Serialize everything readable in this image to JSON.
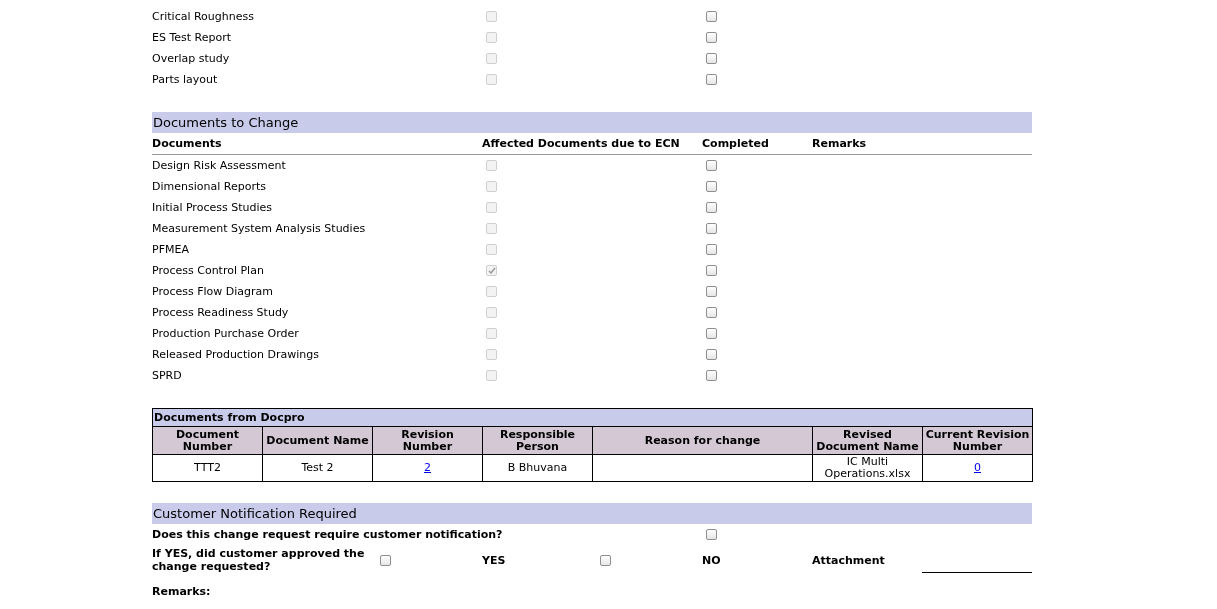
{
  "top_documents": [
    {
      "name": "Critical Roughness",
      "affected": {
        "checked": false,
        "disabled": true
      },
      "completed": {
        "checked": false,
        "disabled": false
      }
    },
    {
      "name": "ES Test Report",
      "affected": {
        "checked": false,
        "disabled": true
      },
      "completed": {
        "checked": false,
        "disabled": false
      }
    },
    {
      "name": "Overlap study",
      "affected": {
        "checked": false,
        "disabled": true
      },
      "completed": {
        "checked": false,
        "disabled": false
      }
    },
    {
      "name": "Parts layout",
      "affected": {
        "checked": false,
        "disabled": true
      },
      "completed": {
        "checked": false,
        "disabled": false
      }
    }
  ],
  "documents_to_change": {
    "title": "Documents to Change",
    "columns": [
      "Documents",
      "Affected Documents due to ECN",
      "Completed",
      "Remarks"
    ],
    "rows": [
      {
        "name": "Design Risk Assessment",
        "affected": {
          "checked": false,
          "disabled": true
        },
        "completed": {
          "checked": false,
          "disabled": false
        }
      },
      {
        "name": "Dimensional Reports",
        "affected": {
          "checked": false,
          "disabled": true
        },
        "completed": {
          "checked": false,
          "disabled": false
        }
      },
      {
        "name": "Initial Process Studies",
        "affected": {
          "checked": false,
          "disabled": true
        },
        "completed": {
          "checked": false,
          "disabled": false
        }
      },
      {
        "name": "Measurement System Analysis Studies",
        "affected": {
          "checked": false,
          "disabled": true
        },
        "completed": {
          "checked": false,
          "disabled": false
        }
      },
      {
        "name": "PFMEA",
        "affected": {
          "checked": false,
          "disabled": true
        },
        "completed": {
          "checked": false,
          "disabled": false
        }
      },
      {
        "name": "Process Control Plan",
        "affected": {
          "checked": true,
          "disabled": true
        },
        "completed": {
          "checked": false,
          "disabled": false
        }
      },
      {
        "name": "Process Flow Diagram",
        "affected": {
          "checked": false,
          "disabled": true
        },
        "completed": {
          "checked": false,
          "disabled": false
        }
      },
      {
        "name": "Process Readiness Study",
        "affected": {
          "checked": false,
          "disabled": true
        },
        "completed": {
          "checked": false,
          "disabled": false
        }
      },
      {
        "name": "Production Purchase Order",
        "affected": {
          "checked": false,
          "disabled": true
        },
        "completed": {
          "checked": false,
          "disabled": false
        }
      },
      {
        "name": "Released Production Drawings",
        "affected": {
          "checked": false,
          "disabled": true
        },
        "completed": {
          "checked": false,
          "disabled": false
        }
      },
      {
        "name": "SPRD",
        "affected": {
          "checked": false,
          "disabled": true
        },
        "completed": {
          "checked": false,
          "disabled": false
        }
      }
    ]
  },
  "docpro": {
    "title": "Documents from Docpro",
    "columns": [
      "Document Number",
      "Document Name",
      "Revision Number",
      "Responsible Person",
      "Reason for change",
      "Revised Document Name",
      "Current Revision Number"
    ],
    "rows": [
      [
        {
          "text": "TTT2",
          "kind": "text"
        },
        {
          "text": "Test 2",
          "kind": "text"
        },
        {
          "text": "2",
          "kind": "link"
        },
        {
          "text": "B Bhuvana",
          "kind": "text"
        },
        {
          "text": "",
          "kind": "text"
        },
        {
          "text": "IC Multi Operations.xlsx",
          "kind": "text"
        },
        {
          "text": "0",
          "kind": "link"
        }
      ]
    ]
  },
  "customer_notification": {
    "title": "Customer Notification Required",
    "question": "Does this change request require customer notification?",
    "notification": {
      "checked": false,
      "disabled": false
    },
    "approval_label": "If YES, did customer approved the change requested?",
    "yes": {
      "checked": false,
      "disabled": false,
      "label": "YES"
    },
    "no": {
      "checked": false,
      "disabled": false,
      "label": "NO"
    },
    "attachment_label": "Attachment",
    "remarks_label": "Remarks:"
  }
}
